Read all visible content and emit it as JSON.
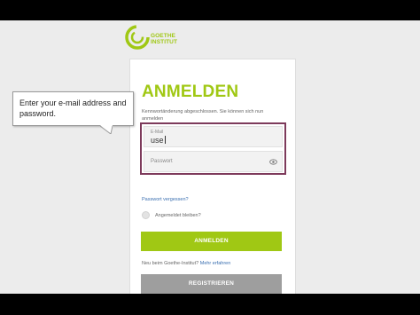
{
  "logo": {
    "line1": "GOETHE",
    "line2": "INSTITUT",
    "color": "#a0c814"
  },
  "form": {
    "title": "ANMELDEN",
    "notice": "Kennwortänderung abgeschlossen. Sie können sich nun anmelden",
    "email": {
      "label": "E-Mail",
      "value": "use"
    },
    "password": {
      "placeholder": "Passwort",
      "icon": "eye-icon"
    },
    "forgot_link": "Passwort vergessen?",
    "remember_label": "Angemeldet bleiben?",
    "login_button": "ANMELDEN",
    "question_text": "Neu beim Goethe-Institut?",
    "question_link": "Mehr erfahren",
    "register_button": "REGISTRIEREN"
  },
  "tooltip": {
    "text": "Enter your e-mail address and password."
  },
  "colors": {
    "accent": "#a0c814",
    "highlight_border": "#7d3a5b",
    "link": "#3a6fb0",
    "register": "#9e9e9e"
  }
}
